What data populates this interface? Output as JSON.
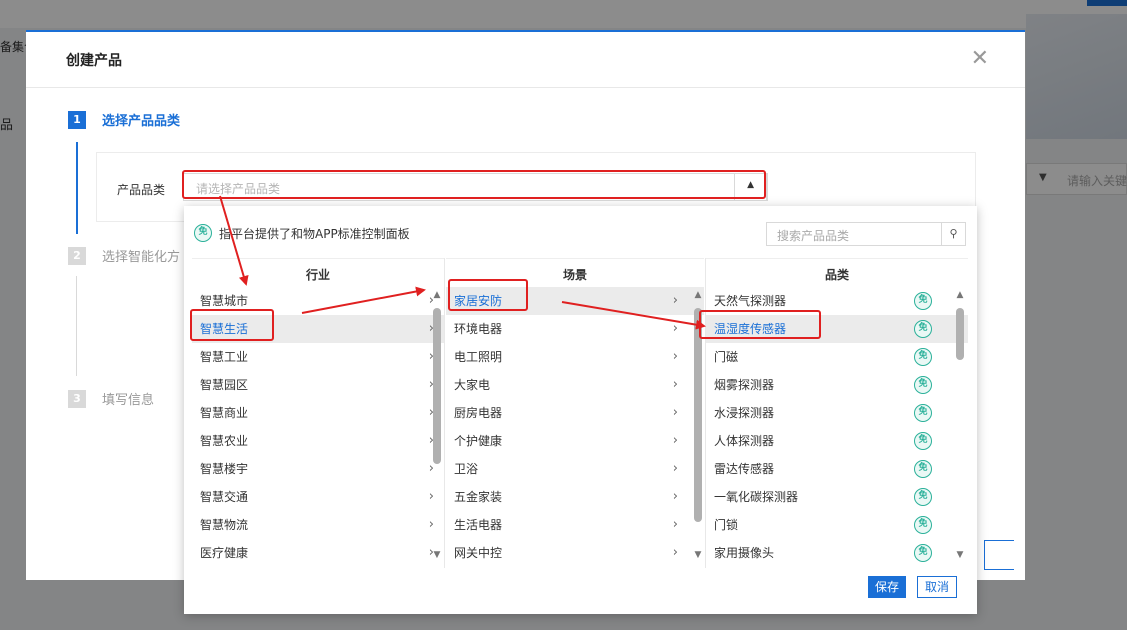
{
  "background": {
    "left_text_1": "备集合",
    "left_text_2": "品",
    "search_placeholder": "请输入关键"
  },
  "modal": {
    "title": "创建产品",
    "close_icon": "close-icon",
    "steps": [
      {
        "num": "1",
        "label": "选择产品品类"
      },
      {
        "num": "2",
        "label": "选择智能化方"
      },
      {
        "num": "3",
        "label": "填写信息"
      }
    ],
    "form": {
      "label": "产品品类",
      "placeholder": "请选择产品品类"
    }
  },
  "dropdown": {
    "badge": "免",
    "note": "指平台提供了和物APP标准控制面板",
    "search_placeholder": "搜索产品品类",
    "columns": {
      "industry": {
        "header": "行业",
        "items": [
          "智慧城市",
          "智慧生活",
          "智慧工业",
          "智慧园区",
          "智慧商业",
          "智慧农业",
          "智慧楼宇",
          "智慧交通",
          "智慧物流",
          "医疗健康"
        ],
        "selected": "智慧生活"
      },
      "scene": {
        "header": "场景",
        "items": [
          "家居安防",
          "环境电器",
          "电工照明",
          "大家电",
          "厨房电器",
          "个护健康",
          "卫浴",
          "五金家装",
          "生活电器",
          "网关中控"
        ],
        "selected": "家居安防"
      },
      "category": {
        "header": "品类",
        "items": [
          "天然气探测器",
          "温湿度传感器",
          "门磁",
          "烟雾探测器",
          "水浸探测器",
          "人体探测器",
          "雷达传感器",
          "一氧化碳探测器",
          "门锁",
          "家用摄像头"
        ],
        "selected": "温湿度传感器"
      }
    },
    "save_label": "保存",
    "cancel_label": "取消"
  },
  "colors": {
    "accent": "#1a6fd6",
    "badge": "#2bb19a",
    "annotation": "#e02020"
  }
}
